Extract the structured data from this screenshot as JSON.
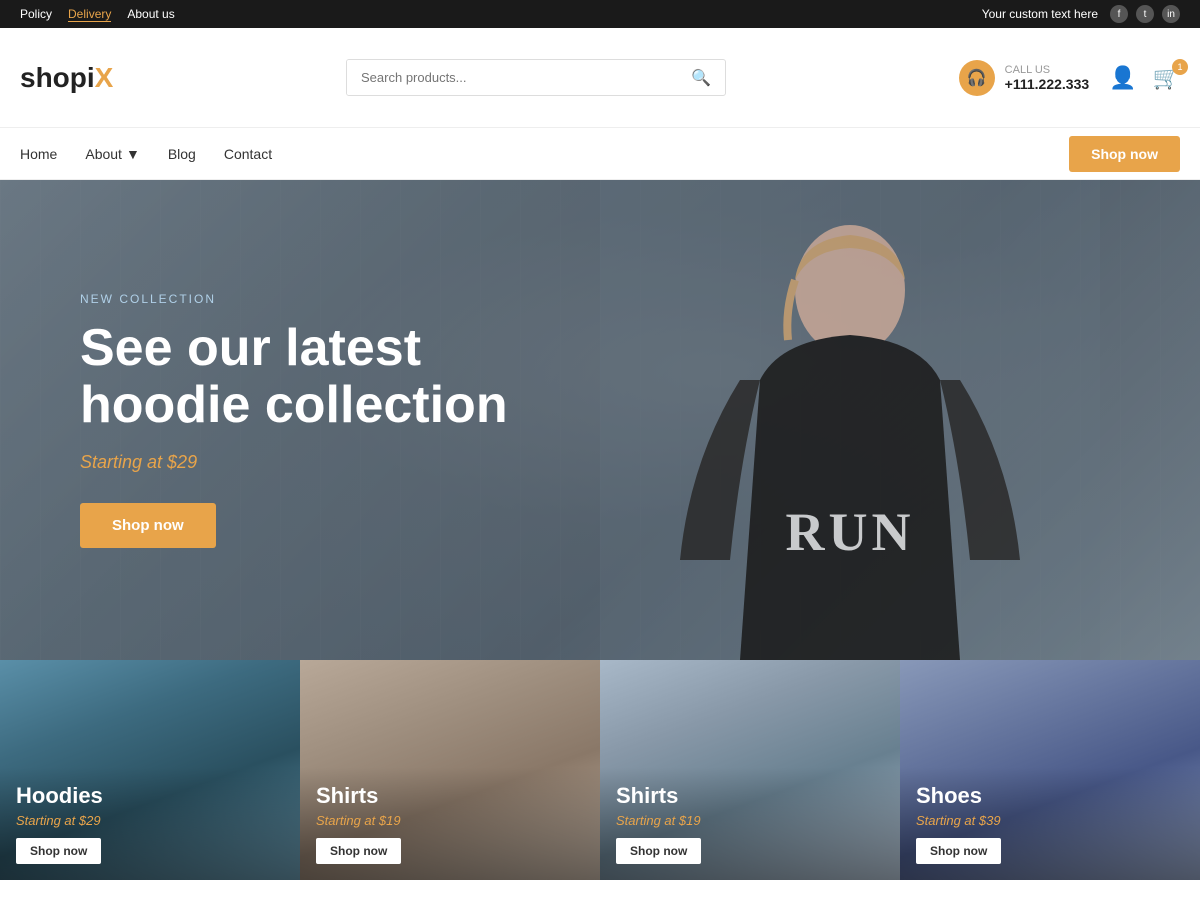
{
  "topbar": {
    "links": [
      {
        "label": "Policy",
        "active": false
      },
      {
        "label": "Delivery",
        "active": true
      },
      {
        "label": "About us",
        "active": false
      }
    ],
    "custom_text": "Your custom text here",
    "social": [
      "f",
      "t",
      "ig"
    ]
  },
  "header": {
    "logo_text": "shopi",
    "logo_x": "X",
    "search_placeholder": "Search products...",
    "call_label": "CALL US",
    "call_number": "+111.222.333",
    "cart_count": "1"
  },
  "nav": {
    "items": [
      {
        "label": "Home",
        "has_dropdown": false
      },
      {
        "label": "About",
        "has_dropdown": true
      },
      {
        "label": "Blog",
        "has_dropdown": false
      },
      {
        "label": "Contact",
        "has_dropdown": false
      }
    ],
    "shop_now_label": "Shop now"
  },
  "hero": {
    "tag": "NEW COLLECTION",
    "title_line1": "See our latest",
    "title_line2": "hoodie collection",
    "price": "Starting at $29",
    "btn_label": "Shop now"
  },
  "products": [
    {
      "name": "Hoodies",
      "price": "Starting at $29",
      "btn_label": "Shop now",
      "bg_class": "card-bg-hoodies"
    },
    {
      "name": "Shirts",
      "price": "Starting at $19",
      "btn_label": "Shop now",
      "bg_class": "card-bg-shirts1"
    },
    {
      "name": "Shirts",
      "price": "Starting at $19",
      "btn_label": "Shop now",
      "bg_class": "card-bg-shirts2"
    },
    {
      "name": "Shoes",
      "price": "Starting at $39",
      "btn_label": "Shop now",
      "bg_class": "card-bg-shoes"
    }
  ]
}
